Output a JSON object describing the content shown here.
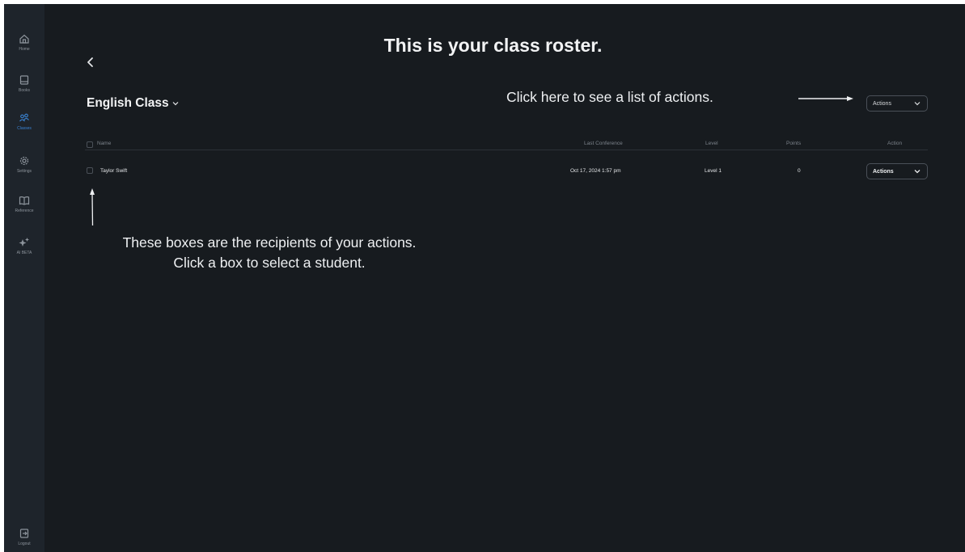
{
  "sidebar": {
    "items": [
      {
        "label": "Home",
        "icon": "home-icon"
      },
      {
        "label": "Books",
        "icon": "book-icon"
      },
      {
        "label": "Classes",
        "icon": "classes-icon"
      },
      {
        "label": "Settings",
        "icon": "gear-icon"
      },
      {
        "label": "Reference",
        "icon": "open-book-icon"
      },
      {
        "label": "AI BETA",
        "icon": "sparkle-icon"
      }
    ],
    "logout": {
      "label": "Logout",
      "icon": "logout-icon"
    },
    "active_color": "#3a84d6"
  },
  "page": {
    "title": "This is your class roster.",
    "class_name": "English Class"
  },
  "annotations": {
    "actions_hint": "Click here to see a list of actions.",
    "boxes_hint_line1": "These boxes are the recipients of your actions.",
    "boxes_hint_line2": "Click a box to select a student."
  },
  "toolbar": {
    "actions_label": "Actions"
  },
  "table": {
    "columns": [
      "Name",
      "Last Conference",
      "Level",
      "Points",
      "Action"
    ],
    "rows": [
      {
        "name": "Taylor Swift",
        "last_conference": "Oct 17, 2024 1:57 pm",
        "level": "Level 1",
        "points": "0",
        "action": "Actions"
      }
    ]
  }
}
